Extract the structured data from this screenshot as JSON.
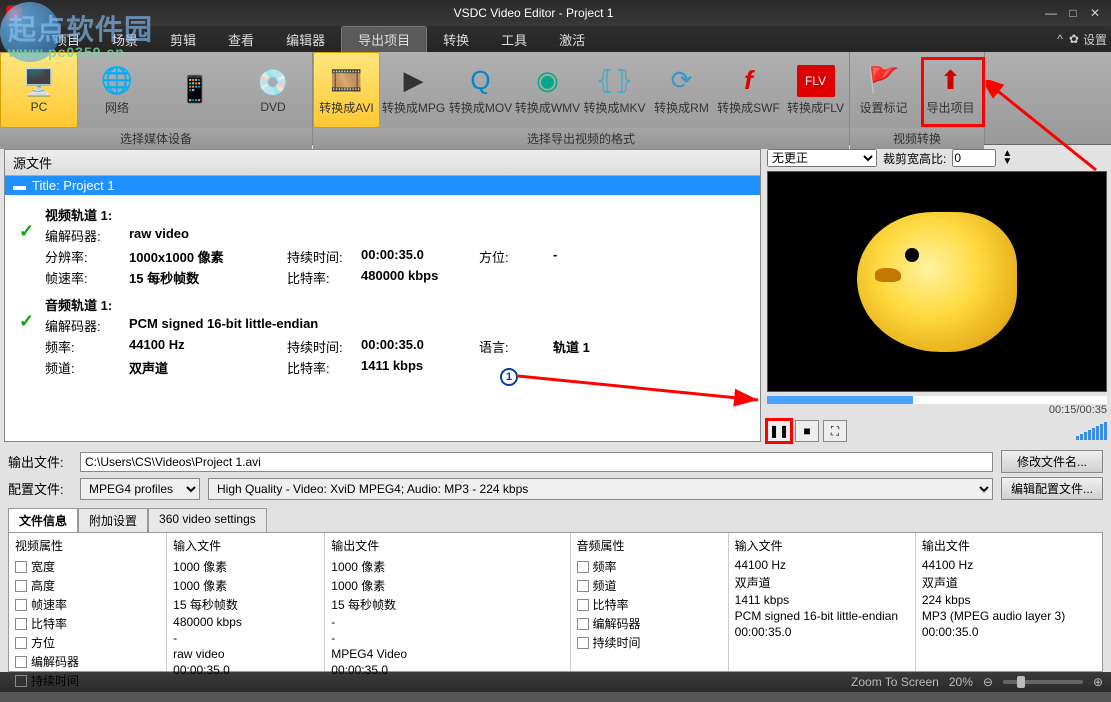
{
  "titlebar": {
    "title": "VSDC Video Editor - Project 1"
  },
  "watermark": {
    "text": "起点软件园",
    "url": "www.pc0359.cn"
  },
  "menubar": {
    "items": [
      "项目",
      "场景",
      "剪辑",
      "查看",
      "编辑器",
      "导出项目",
      "转换",
      "工具",
      "激活"
    ],
    "active_index": 5,
    "settings": "设置"
  },
  "ribbon": {
    "group1": {
      "label": "选择媒体设备",
      "buttons": [
        {
          "label": "PC"
        },
        {
          "label": "网络"
        },
        {
          "label": ""
        },
        {
          "label": "DVD"
        }
      ]
    },
    "group2": {
      "label": "选择导出视频的格式",
      "buttons": [
        {
          "label": "转换成AVI"
        },
        {
          "label": "转换成MPG"
        },
        {
          "label": "转换成MOV"
        },
        {
          "label": "转换成WMV"
        },
        {
          "label": "转换成MKV"
        },
        {
          "label": "转换成RM"
        },
        {
          "label": "转换成SWF"
        },
        {
          "label": "转换成FLV"
        }
      ]
    },
    "group3": {
      "label": "视频转换",
      "buttons": [
        {
          "label": "设置标记"
        },
        {
          "label": "导出项目"
        }
      ]
    }
  },
  "source": {
    "header": "源文件",
    "title_row": "Title: Project 1",
    "video_track": {
      "title": "视频轨道 1:",
      "codec_lbl": "编解码器:",
      "codec": "raw video",
      "res_lbl": "分辨率:",
      "res": "1000x1000 像素",
      "dur_lbl": "持续时间:",
      "dur": "00:00:35.0",
      "orient_lbl": "方位:",
      "orient": "-",
      "fps_lbl": "帧速率:",
      "fps": "15 每秒帧数",
      "br_lbl": "比特率:",
      "br": "480000 kbps"
    },
    "audio_track": {
      "title": "音频轨道 1:",
      "codec_lbl": "编解码器:",
      "codec": "PCM signed 16-bit little-endian",
      "freq_lbl": "频率:",
      "freq": "44100 Hz",
      "dur_lbl": "持续时间:",
      "dur": "00:00:35.0",
      "lang_lbl": "语言:",
      "lang": "轨道 1",
      "ch_lbl": "频道:",
      "ch": "双声道",
      "br_lbl": "比特率:",
      "br": "1411 kbps"
    }
  },
  "preview": {
    "aspect_select": "无更正",
    "crop_lbl": "裁剪宽高比:",
    "crop_val": "0",
    "time": "00:15/00:35",
    "progress_pct": 43
  },
  "output": {
    "file_lbl": "输出文件:",
    "file_path": "C:\\Users\\CS\\Videos\\Project 1.avi",
    "file_btn": "修改文件名...",
    "profile_lbl": "配置文件:",
    "profile_sel": "MPEG4 profiles",
    "profile_desc": "High Quality - Video: XviD MPEG4; Audio: MP3 - 224 kbps",
    "profile_btn": "编辑配置文件..."
  },
  "tabs": {
    "items": [
      "文件信息",
      "附加设置",
      "360 video settings"
    ],
    "active_index": 0
  },
  "info": {
    "video": {
      "header": "视频属性",
      "rows": [
        "宽度",
        "高度",
        "帧速率",
        "比特率",
        "方位",
        "编解码器",
        "持续时间"
      ]
    },
    "vin": {
      "header": "输入文件",
      "rows": [
        "1000 像素",
        "1000 像素",
        "15 每秒帧数",
        "480000 kbps",
        "-",
        "raw video",
        "00:00:35.0"
      ]
    },
    "vout": {
      "header": "输出文件",
      "rows": [
        "1000 像素",
        "1000 像素",
        "15 每秒帧数",
        "-",
        "-",
        "MPEG4 Video",
        "00:00:35.0"
      ]
    },
    "audio": {
      "header": "音频属性",
      "rows": [
        "频率",
        "频道",
        "比特率",
        "编解码器",
        "持续时间"
      ]
    },
    "ain": {
      "header": "输入文件",
      "rows": [
        "44100 Hz",
        "双声道",
        "1411 kbps",
        "PCM signed 16-bit little-endian",
        "00:00:35.0"
      ]
    },
    "aout": {
      "header": "输出文件",
      "rows": [
        "44100 Hz",
        "双声道",
        "224 kbps",
        "MP3 (MPEG audio layer 3)",
        "00:00:35.0"
      ]
    }
  },
  "status": {
    "zoom_lbl": "Zoom To Screen",
    "zoom_pct": "20%"
  }
}
